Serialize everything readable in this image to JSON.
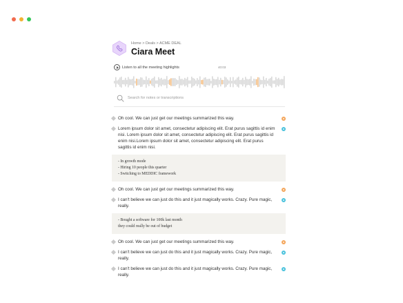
{
  "colors": {
    "dot_red": "#f26b4e",
    "dot_yellow": "#f2b233",
    "dot_green": "#34c759",
    "accent_purple": "#c9a3f0",
    "wave_gray": "#c8c8c8",
    "wave_highlight": "#f2a552",
    "speaker_orange": "#f4a65b",
    "speaker_blue": "#4cc3dd"
  },
  "header": {
    "breadcrumb": "Home > Deals > ACME DEAL",
    "title": "Ciara Meet",
    "icon": "phone-icon"
  },
  "player": {
    "label": "Listen to all the meeting highlights",
    "duration": "40:03",
    "play_icon": "play-icon"
  },
  "search": {
    "placeholder": "Search for notes or transcriptions",
    "value": "",
    "icon": "search-icon"
  },
  "transcript": [
    {
      "type": "utterance",
      "speaker": "orange",
      "text": "Oh cool. We can just get our meetings summarized this way."
    },
    {
      "type": "utterance",
      "speaker": "blue",
      "text": "Lorem ipsum dolor sit amet, consectetur adipiscing elit. Erat purus sagittis id enim nisi. Lorem ipsum dolor sit amet, consectetur adipiscing elit. Erat purus sagittis id enim nisi.Lorem ipsum dolor sit amet, consectetur adipiscing elit. Erat purus sagittis id enim nisi."
    },
    {
      "type": "note",
      "lines": [
        "- In growth mode",
        "- Hiring 10 people this quarter",
        "- Switching to MEDDIC framework"
      ]
    },
    {
      "type": "utterance",
      "speaker": "orange",
      "text": "Oh cool. We can just get our meetings summarized this way."
    },
    {
      "type": "utterance",
      "speaker": "blue",
      "text": "I can't believe we can just do this and it just magically works. Crazy. Pure magic, really."
    },
    {
      "type": "note",
      "lines": [
        "- Bought a software for 100k last month",
        "they could really be out of budget"
      ]
    },
    {
      "type": "utterance",
      "speaker": "orange",
      "text": "Oh cool. We can just get our meetings summarized this way."
    },
    {
      "type": "utterance",
      "speaker": "blue",
      "text": "I can't believe we can just do this and it just magically works. Crazy. Pure magic, really."
    },
    {
      "type": "utterance",
      "speaker": "blue",
      "text": "I can't believe we can just do this and it just magically works. Crazy. Pure magic, really."
    }
  ]
}
